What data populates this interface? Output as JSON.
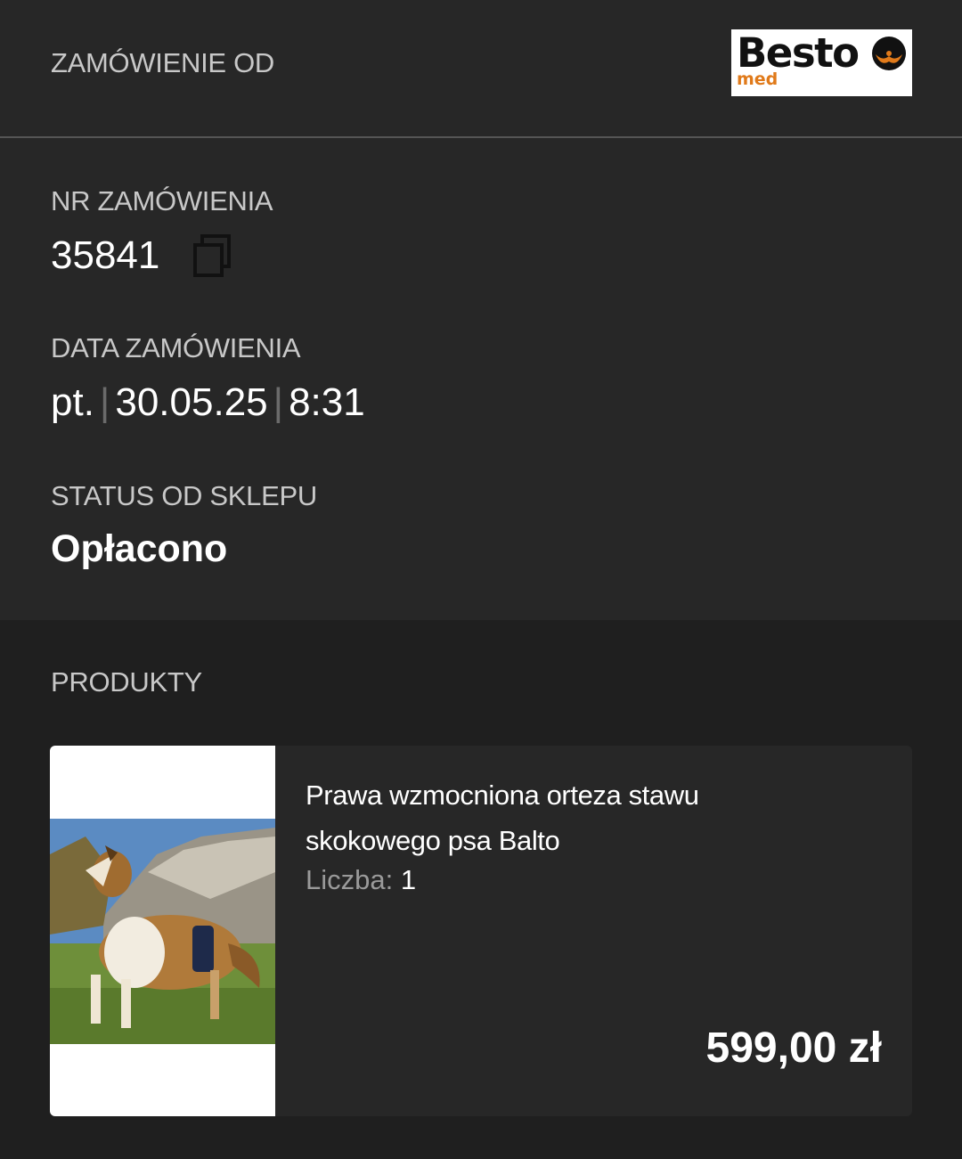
{
  "header": {
    "title": "ZAMÓWIENIE OD",
    "logo": {
      "word": "Besto",
      "sub": "med",
      "accent_color": "#e07a1a"
    }
  },
  "order": {
    "number_label": "NR ZAMÓWIENIA",
    "number": "35841",
    "copy_icon": "copy-icon",
    "date_label": "DATA ZAMÓWIENIA",
    "date_day": "pt.",
    "date_separator": "|",
    "date": "30.05.25",
    "time": "8:31",
    "status_label": "STATUS OD SKLEPU",
    "status": "Opłacono"
  },
  "products": {
    "label": "PRODUKTY",
    "items": [
      {
        "name": "Prawa wzmocniona orteza stawu skokowego psa Balto",
        "qty_label": "Liczba:",
        "qty": "1",
        "price": "599,00 zł"
      }
    ]
  }
}
